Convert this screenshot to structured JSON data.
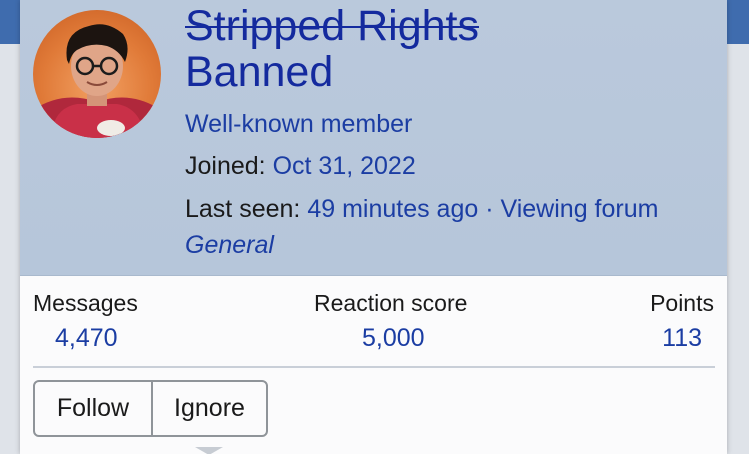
{
  "user": {
    "username": "Stripped Rights",
    "status": "Banned",
    "title": "Well-known member",
    "joined_label": "Joined:",
    "joined_value": "Oct 31, 2022",
    "last_seen_label": "Last seen:",
    "last_seen_value": "49 minutes ago",
    "activity_sep": "·",
    "activity": "Viewing forum",
    "activity_target": "General"
  },
  "stats": {
    "messages_label": "Messages",
    "messages_value": "4,470",
    "reaction_label": "Reaction score",
    "reaction_value": "5,000",
    "points_label": "Points",
    "points_value": "113"
  },
  "actions": {
    "follow_label": "Follow",
    "ignore_label": "Ignore"
  },
  "colors": {
    "header_bg": "#bac9dc",
    "link": "#1b3da3",
    "username": "#142a9e",
    "avatar_bg": "#e07a38"
  },
  "icons": {
    "avatar": "user-avatar-image"
  }
}
